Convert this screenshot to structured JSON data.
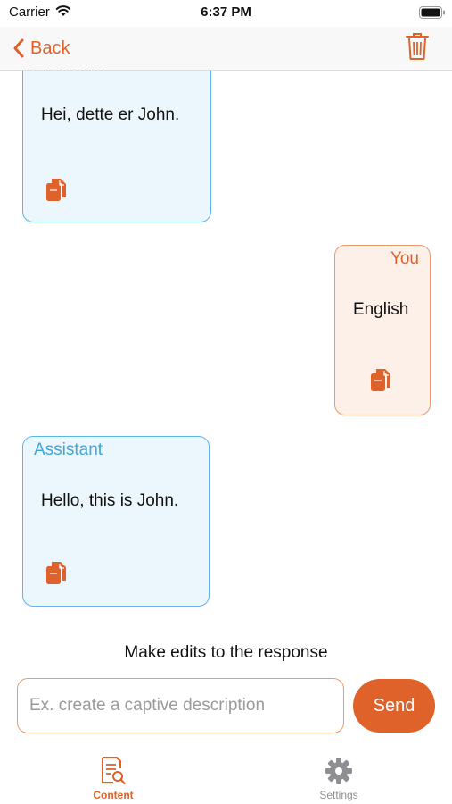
{
  "status_bar": {
    "carrier": "Carrier",
    "time": "6:37 PM"
  },
  "navbar": {
    "back_label": "Back",
    "icons": [
      "chevron-left-icon",
      "trash-icon"
    ]
  },
  "messages": [
    {
      "role": "Assistant",
      "text": "Hei, dette er John."
    },
    {
      "role": "You",
      "text": "English"
    },
    {
      "role": "Assistant",
      "text": "Hello, this is John."
    }
  ],
  "composer": {
    "hint": "Make edits to the response",
    "placeholder": "Ex. create a captive description",
    "value": "",
    "send_label": "Send"
  },
  "tabbar": {
    "tabs": [
      {
        "label": "Content",
        "icon": "document-search-icon",
        "active": true
      },
      {
        "label": "Settings",
        "icon": "gear-icon",
        "active": false
      }
    ]
  },
  "colors": {
    "accent": "#e0622b",
    "assistant_border": "#5ab8e6",
    "assistant_bg": "#ebf6fd",
    "user_border": "#e99a6f",
    "user_bg": "#fdf0e9"
  }
}
